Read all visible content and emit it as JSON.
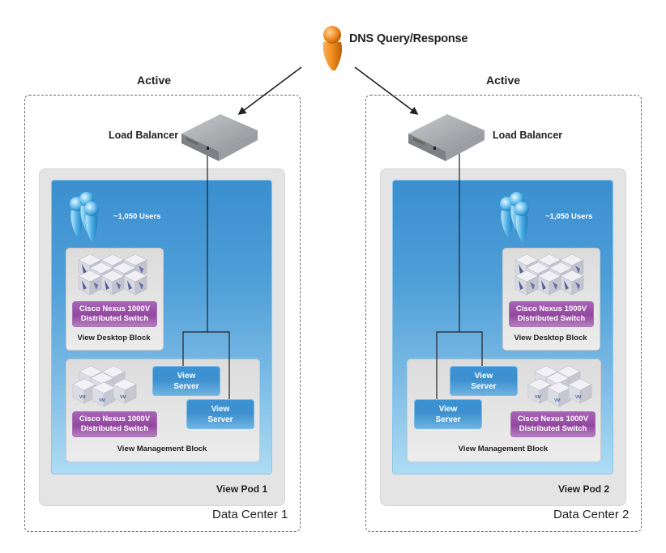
{
  "dns": {
    "label": "DNS Query/Response",
    "icon": "person-icon",
    "color": "#f08a1d"
  },
  "datacenters": [
    {
      "name": "Data Center 1",
      "status": "Active",
      "load_balancer": {
        "label": "Load Balancer"
      },
      "pod": {
        "name": "View Pod 1",
        "users": "~1,050 Users",
        "desktop_block": {
          "label": "View Desktop Block",
          "switch_line1": "Cisco Nexus 1000V",
          "switch_line2": "Distributed Switch"
        },
        "management_block": {
          "label": "View Management Block",
          "switch_line1": "Cisco Nexus 1000V",
          "switch_line2": "Distributed Switch",
          "vm_label": "VM",
          "servers": [
            {
              "line1": "View",
              "line2": "Server"
            },
            {
              "line1": "View",
              "line2": "Server"
            }
          ]
        }
      }
    },
    {
      "name": "Data Center 2",
      "status": "Active",
      "load_balancer": {
        "label": "Load Balancer"
      },
      "pod": {
        "name": "View Pod 2",
        "users": "~1,050 Users",
        "desktop_block": {
          "label": "View Desktop Block",
          "switch_line1": "Cisco Nexus 1000V",
          "switch_line2": "Distributed Switch"
        },
        "management_block": {
          "label": "View Management Block",
          "switch_line1": "Cisco Nexus 1000V",
          "switch_line2": "Distributed Switch",
          "vm_label": "VM",
          "servers": [
            {
              "line1": "View",
              "line2": "Server"
            },
            {
              "line1": "View",
              "line2": "Server"
            }
          ]
        }
      }
    }
  ],
  "colors": {
    "pod_blue": "#3a8fcf",
    "switch_purple": "#93479f",
    "server_blue": "#3b93d3",
    "dns_orange": "#f08a1d",
    "users_blue": "#5fb6e6"
  }
}
